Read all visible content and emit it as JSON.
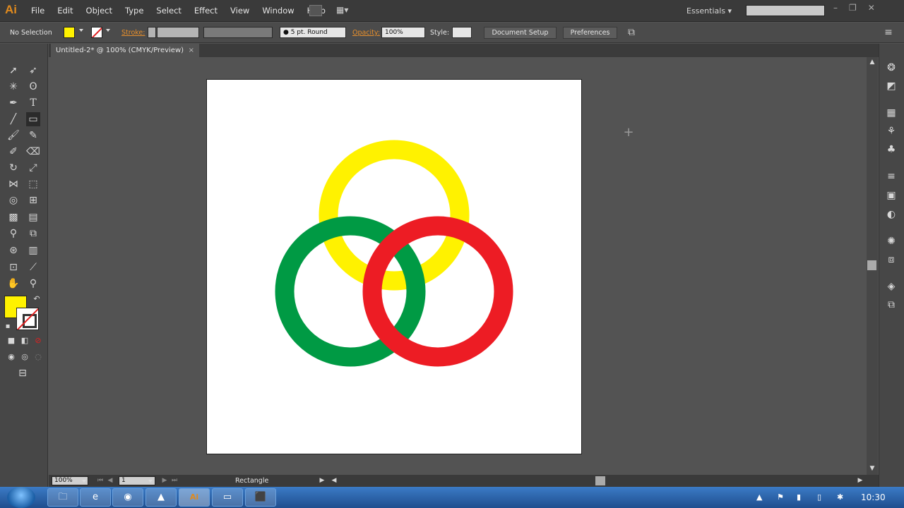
{
  "app": {
    "logo": "Ai"
  },
  "menu": [
    "File",
    "Edit",
    "Object",
    "Type",
    "Select",
    "Effect",
    "View",
    "Window",
    "Help"
  ],
  "workspace_switcher": "Essentials",
  "control_bar": {
    "selection": "No Selection",
    "stroke_label": "Stroke:",
    "brush": "5 pt. Round",
    "opacity_label": "Opacity:",
    "opacity_value": "100%",
    "style_label": "Style:",
    "doc_setup": "Document Setup",
    "preferences": "Preferences"
  },
  "document_tab": {
    "title": "Untitled-2* @ 100% (CMYK/Preview)",
    "close": "×"
  },
  "status": {
    "zoom": "100%",
    "page": "1",
    "current_tool": "Rectangle"
  },
  "colors": {
    "fill": "#fff200",
    "yellow_ring": "#fff200",
    "green_ring": "#009a44",
    "red_ring": "#ed1c24"
  },
  "taskbar": {
    "clock": "10:30",
    "ai_label": "Ai"
  }
}
